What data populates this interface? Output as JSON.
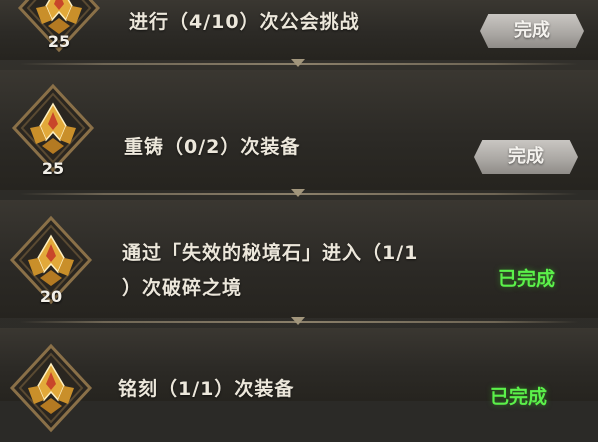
{
  "tasks": [
    {
      "reward": "25",
      "line1": "进行（4/10）次公会挑战",
      "line2": "",
      "action": "完成"
    },
    {
      "reward": "25",
      "line1": "重铸（0/2）次装备",
      "line2": "",
      "action": "完成"
    },
    {
      "reward": "20",
      "line1": "通过「失效的秘境石」进入（1/1",
      "line2": "）次破碎之境",
      "action": "已完成"
    },
    {
      "reward": "",
      "line1": "铭刻（1/1）次装备",
      "line2": "",
      "action": "已完成"
    }
  ],
  "colors": {
    "done_status": "#5bf14a",
    "badge_gold": "#e2a93a",
    "badge_frame": "#8a7048"
  },
  "icons": {
    "reward": "gold-crest-icon"
  }
}
